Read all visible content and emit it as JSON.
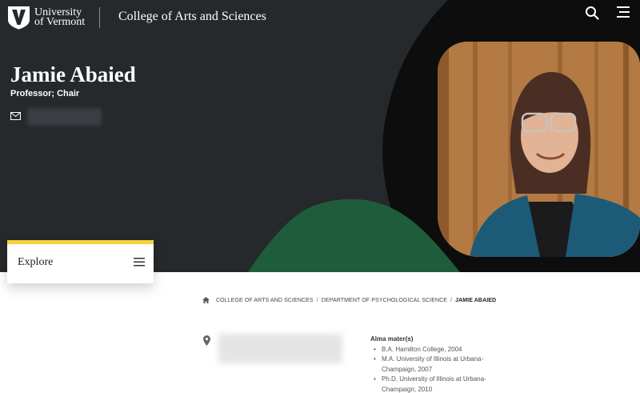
{
  "header": {
    "university_line1": "University",
    "university_line2": "of Vermont",
    "college_name": "College of Arts and Sciences",
    "search_icon": "search-icon",
    "menu_icon": "hamburger-menu-icon"
  },
  "profile": {
    "name": "Jamie Abaied",
    "title": "Professor; Chair",
    "email_icon": "mail-icon",
    "photo_alt": "Portrait of Jamie Abaied"
  },
  "explore": {
    "label": "Explore",
    "icon": "hamburger-menu-icon"
  },
  "breadcrumb": {
    "home_icon": "home-icon",
    "items": [
      "COLLEGE OF ARTS AND SCIENCES",
      "DEPARTMENT OF PSYCHOLOGICAL SCIENCE",
      "JAMIE ABAIED"
    ]
  },
  "location": {
    "icon": "location-pin-icon"
  },
  "alma_mater": {
    "title": "Alma mater(s)",
    "items": [
      "B.A. Hamilton College, 2004",
      "M.A. University of Illinois at Urbana-Champaign, 2007",
      "Ph.D. University of Illinois at Urbana-Champaign, 2010"
    ]
  },
  "colors": {
    "hero_bg": "#26292c",
    "accent_yellow": "#f3d23b",
    "accent_green": "#1f5c3c",
    "black_shape": "#0d0d0d"
  }
}
